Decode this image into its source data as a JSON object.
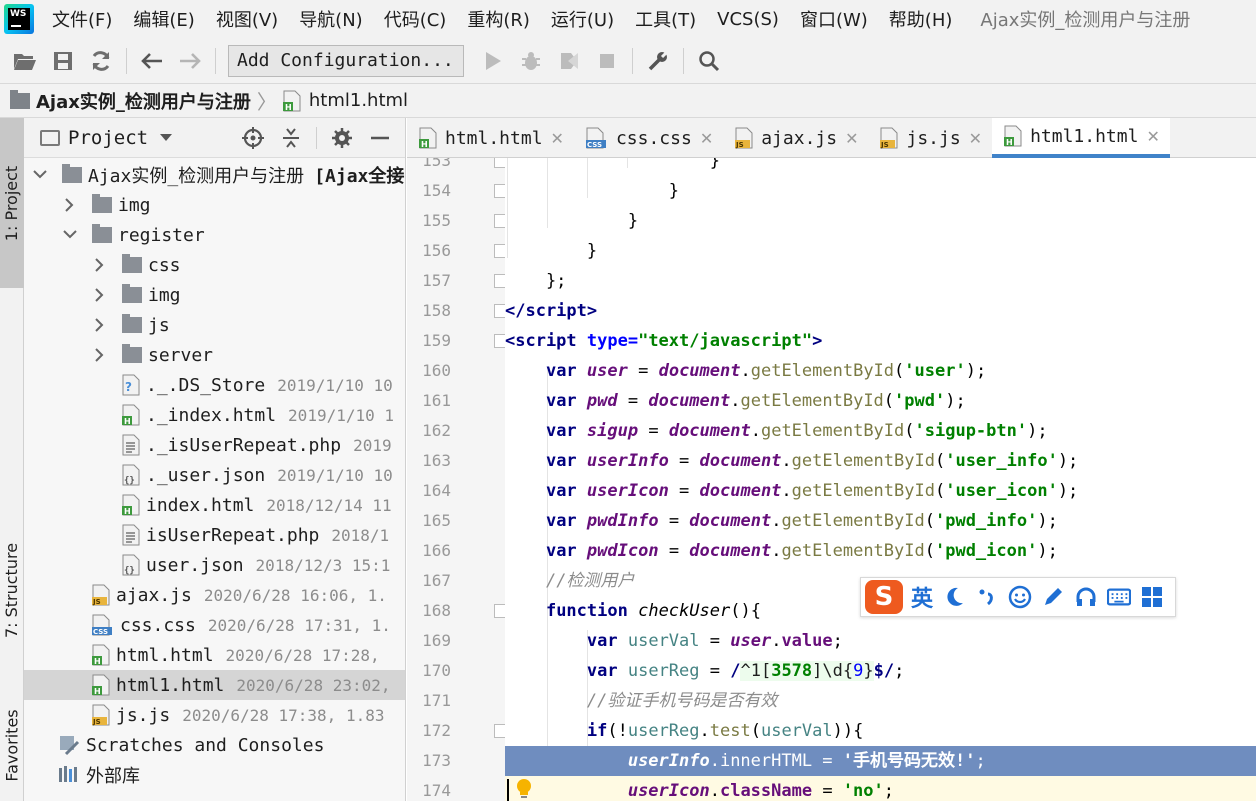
{
  "menubar": {
    "items": [
      "文件(F)",
      "编辑(E)",
      "视图(V)",
      "导航(N)",
      "代码(C)",
      "重构(R)",
      "运行(U)",
      "工具(T)",
      "VCS(S)",
      "窗口(W)",
      "帮助(H)"
    ],
    "window_title": "Ajax实例_检测用户与注册"
  },
  "toolbar": {
    "config_label": "Add Configuration..."
  },
  "breadcrumb": {
    "project": "Ajax实例_检测用户与注册",
    "file": "html1.html"
  },
  "left_stripe": {
    "project_tab": "1: Project",
    "structure_tab": "7: Structure",
    "favorites_tab": "Favorites"
  },
  "project_panel": {
    "title": "Project",
    "tree": [
      {
        "name": "Ajax实例_检测用户与注册",
        "extra": "[Ajax全接",
        "meta": "",
        "kind": "folder",
        "depth": 0,
        "expanded": true
      },
      {
        "name": "img",
        "extra": "",
        "meta": "",
        "kind": "folder",
        "depth": 1,
        "expanded": false
      },
      {
        "name": "register",
        "extra": "",
        "meta": "",
        "kind": "folder",
        "depth": 1,
        "expanded": true
      },
      {
        "name": "css",
        "extra": "",
        "meta": "",
        "kind": "folder",
        "depth": 2,
        "expanded": false
      },
      {
        "name": "img",
        "extra": "",
        "meta": "",
        "kind": "folder",
        "depth": 2,
        "expanded": false
      },
      {
        "name": "js",
        "extra": "",
        "meta": "",
        "kind": "folder",
        "depth": 2,
        "expanded": false
      },
      {
        "name": "server",
        "extra": "",
        "meta": "",
        "kind": "folder",
        "depth": 2,
        "expanded": false
      },
      {
        "name": "._.DS_Store",
        "extra": "",
        "meta": "2019/1/10 10",
        "kind": "unknown",
        "depth": 3
      },
      {
        "name": "._index.html",
        "extra": "",
        "meta": "2019/1/10 1",
        "kind": "html",
        "depth": 3
      },
      {
        "name": "._isUserRepeat.php",
        "extra": "",
        "meta": "2019",
        "kind": "php",
        "depth": 3
      },
      {
        "name": "._user.json",
        "extra": "",
        "meta": "2019/1/10 10",
        "kind": "json",
        "depth": 3
      },
      {
        "name": "index.html",
        "extra": "",
        "meta": "2018/12/14 11",
        "kind": "html",
        "depth": 3
      },
      {
        "name": "isUserRepeat.php",
        "extra": "",
        "meta": "2018/1",
        "kind": "php",
        "depth": 3
      },
      {
        "name": "user.json",
        "extra": "",
        "meta": "2018/12/3 15:1",
        "kind": "json",
        "depth": 3
      },
      {
        "name": "ajax.js",
        "extra": "",
        "meta": "2020/6/28 16:06, 1.",
        "kind": "js",
        "depth": 2
      },
      {
        "name": "css.css",
        "extra": "",
        "meta": "2020/6/28 17:31, 1.",
        "kind": "css",
        "depth": 2
      },
      {
        "name": "html.html",
        "extra": "",
        "meta": "2020/6/28 17:28,",
        "kind": "html",
        "depth": 2
      },
      {
        "name": "html1.html",
        "extra": "",
        "meta": "2020/6/28 23:02,",
        "kind": "html",
        "depth": 2,
        "selected": true
      },
      {
        "name": "js.js",
        "extra": "",
        "meta": "2020/6/28 17:38, 1.83",
        "kind": "js",
        "depth": 2
      },
      {
        "name": "Scratches and Consoles",
        "extra": "",
        "meta": "",
        "kind": "scratch",
        "depth": 0
      },
      {
        "name": "外部库",
        "extra": "",
        "meta": "",
        "kind": "library",
        "depth": 0
      }
    ]
  },
  "editor_tabs": [
    {
      "label": "html.html",
      "kind": "html",
      "active": false
    },
    {
      "label": "css.css",
      "kind": "css",
      "active": false
    },
    {
      "label": "ajax.js",
      "kind": "js",
      "active": false
    },
    {
      "label": "js.js",
      "kind": "js",
      "active": false
    },
    {
      "label": "html1.html",
      "kind": "html",
      "active": true
    }
  ],
  "editor": {
    "line_numbers": [
      "153",
      "154",
      "155",
      "156",
      "157",
      "158",
      "159",
      "160",
      "161",
      "162",
      "163",
      "164",
      "165",
      "166",
      "167",
      "168",
      "169",
      "170",
      "171",
      "172",
      "173",
      "174"
    ],
    "selected_line": "173",
    "caret_line": "174"
  },
  "ime": {
    "mode": "英"
  },
  "colors": {
    "selection": "#6f8dbf",
    "tab_active_underline": "#4083c9",
    "keyword": "#000080",
    "string": "#008000",
    "global_var": "#660e7a",
    "comment": "#8c8c8c"
  }
}
